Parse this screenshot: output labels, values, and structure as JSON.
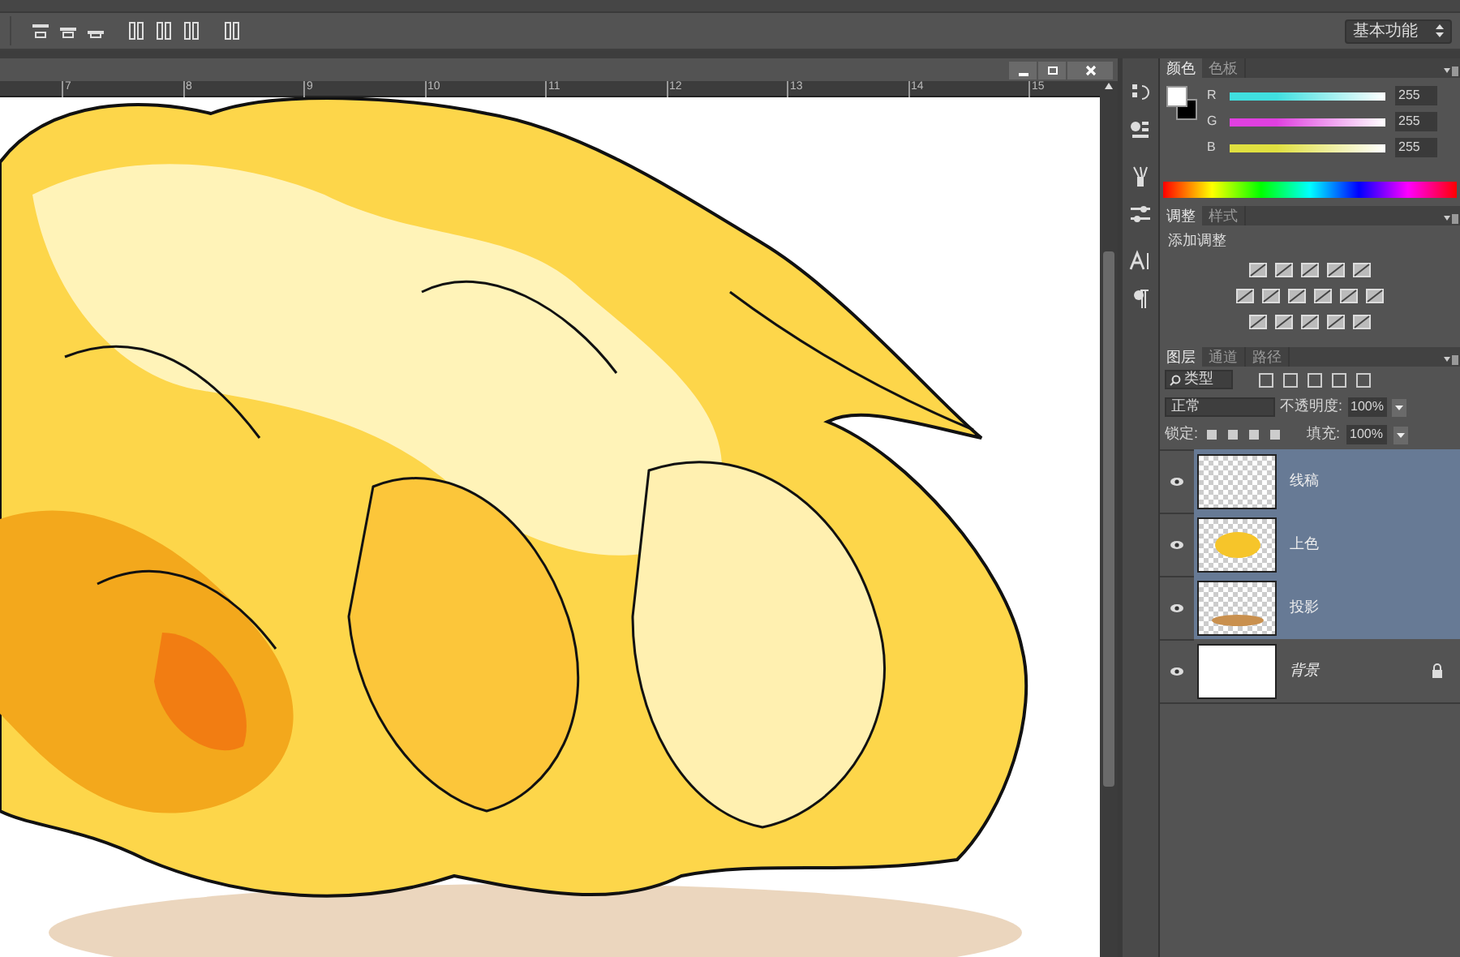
{
  "workspace": {
    "value": "基本功能"
  },
  "ruler": {
    "labels": [
      "7",
      "8",
      "9",
      "10",
      "11",
      "12",
      "13",
      "14",
      "15"
    ]
  },
  "color_panel": {
    "tabs": [
      {
        "label": "颜色",
        "selected": true
      },
      {
        "label": "色板",
        "selected": false
      }
    ],
    "channels": [
      {
        "name": "R",
        "level": 1,
        "reading": "255",
        "color": "#40e0e0"
      },
      {
        "name": "G",
        "level": 1,
        "reading": "255",
        "color": "#e040e0"
      },
      {
        "name": "B",
        "level": 1,
        "reading": "255",
        "color": "#e0e040"
      }
    ]
  },
  "adjustments_panel": {
    "tabs": [
      {
        "label": "调整",
        "selected": true
      },
      {
        "label": "样式",
        "selected": false
      }
    ],
    "heading": "添加调整"
  },
  "layers_panel": {
    "tabs": [
      {
        "label": "图层",
        "selected": true
      },
      {
        "label": "通道",
        "selected": false
      },
      {
        "label": "路径",
        "selected": false
      }
    ],
    "filter": "类型",
    "blend_mode": "正常",
    "opacity_label": "不透明度:",
    "opacity": "100%",
    "lock_label": "锁定:",
    "fill_label": "填充:",
    "fill": "100%",
    "layers": [
      {
        "name": "线稿",
        "kind": "transparent",
        "selected": true,
        "visible": true,
        "locked": false
      },
      {
        "name": "上色",
        "kind": "color",
        "selected": true,
        "visible": true,
        "locked": false
      },
      {
        "name": "投影",
        "kind": "shadow",
        "selected": true,
        "visible": true,
        "locked": false
      },
      {
        "name": "背景",
        "kind": "white",
        "selected": false,
        "visible": true,
        "locked": true
      }
    ]
  }
}
